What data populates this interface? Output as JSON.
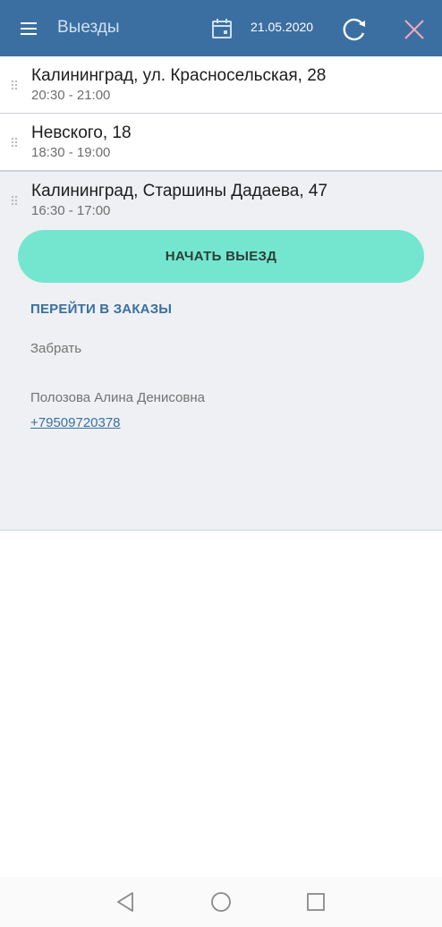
{
  "header": {
    "title": "Выезды",
    "date": "21.05.2020",
    "icons": {
      "menu": "menu-icon",
      "calendar": "calendar-icon",
      "refresh": "refresh-icon",
      "close": "close-icon"
    }
  },
  "trips": [
    {
      "address": "Калининград, ул. Красносельская, 28",
      "time": "20:30 - 21:00"
    },
    {
      "address": "Невского, 18",
      "time": "18:30 - 19:00"
    },
    {
      "address": "Калининград, Старшины Дадаева, 47",
      "time": "16:30 - 17:00",
      "expanded": true,
      "start_label": "НАЧАТЬ ВЫЕЗД",
      "goto_orders_label": "ПЕРЕЙТИ В ЗАКАЗЫ",
      "action_type": "Забрать",
      "customer_name": "Полозова Алина Денисовна",
      "customer_phone": "+79509720378"
    }
  ],
  "colors": {
    "appbar": "#3b6fa1",
    "accent_button": "#74e6cf",
    "link": "#3b6fa1",
    "expanded_bg": "#eef0f3"
  }
}
